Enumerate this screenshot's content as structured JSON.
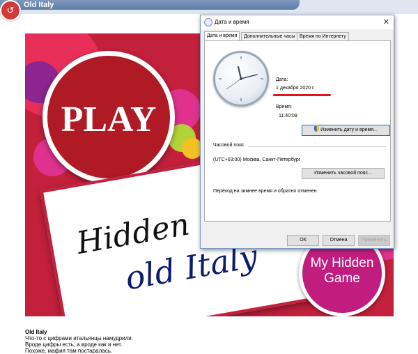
{
  "app": {
    "title": "Old Italy"
  },
  "game": {
    "play_label": "PLAY",
    "card_line1": "Hidden",
    "card_line2": "old Italy",
    "mhg_line1": "My Hidden",
    "mhg_line2": "Game",
    "colors": {
      "background": "#c2203b",
      "play": "#b01a24",
      "mhg": "#c01d7e"
    }
  },
  "description": {
    "title": "Old Italy",
    "lines": [
      "Что-то с цифрами итальянцы намудрили.",
      "Вроде цифры есть, а вроде как и нет.",
      "Похоже, мафия там постаралась."
    ]
  },
  "dialog": {
    "title": "Дата и время",
    "tabs": [
      "Дата и время",
      "Дополнительные часы",
      "Время по Интернету"
    ],
    "date_label": "Дата:",
    "date_value": "1 декабря 2020 г.",
    "time_label": "Время:",
    "time_value": "11:40:09",
    "change_datetime_button": "Изменить дату и время...",
    "timezone_label": "Часовой пояс",
    "timezone_value": "(UTC+03:00) Москва, Санкт-Петербург",
    "change_timezone_button": "Изменить часовой пояс...",
    "dst_note": "Переход на зимнее время и обратно отменен.",
    "ok_button": "ОК",
    "cancel_button": "Отмена",
    "apply_button": "Применить"
  }
}
